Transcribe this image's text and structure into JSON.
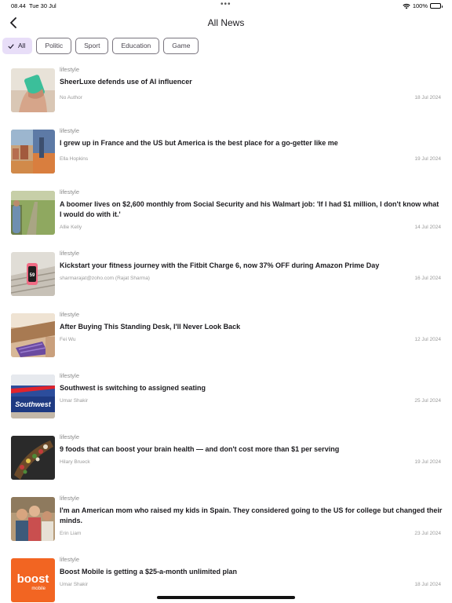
{
  "status_bar": {
    "time": "08.44",
    "date": "Tue 30 Jul",
    "dots": "•••",
    "battery": "100%"
  },
  "header": {
    "title": "All News"
  },
  "filters": [
    {
      "label": "All",
      "selected": true
    },
    {
      "label": "Politic",
      "selected": false
    },
    {
      "label": "Sport",
      "selected": false
    },
    {
      "label": "Education",
      "selected": false
    },
    {
      "label": "Game",
      "selected": false
    }
  ],
  "articles": [
    {
      "category": "lifestyle",
      "title": "SheerLuxe defends use of AI influencer",
      "author": "No Author",
      "date": "18 Jul 2024"
    },
    {
      "category": "lifestyle",
      "title": "I grew up in France and the US but America is the best place for a go-getter like me",
      "author": "Ella Hopkins",
      "date": "19 Jul 2024"
    },
    {
      "category": "lifestyle",
      "title": "A boomer lives on $2,600 monthly from Social Security and his Walmart job: 'If I had $1 million, I don't know what I would do with it.'",
      "author": "Allie Kelly",
      "date": "14 Jul 2024"
    },
    {
      "category": "lifestyle",
      "title": "Kickstart your fitness journey with the Fitbit Charge 6, now 37% OFF during Amazon Prime Day",
      "author": "sharmarajat@zoho.com (Rajat Sharma)",
      "date": "16 Jul 2024"
    },
    {
      "category": "lifestyle",
      "title": "After Buying This Standing Desk, I'll Never Look Back",
      "author": "Fei Wu",
      "date": "12 Jul 2024"
    },
    {
      "category": "lifestyle",
      "title": "Southwest is switching to assigned seating",
      "author": "Umar Shakir",
      "date": "25 Jul 2024"
    },
    {
      "category": "lifestyle",
      "title": "9 foods that can boost your brain health — and don't cost more than $1 per serving",
      "author": "Hilary Brueck",
      "date": "19 Jul 2024"
    },
    {
      "category": "lifestyle",
      "title": "I'm an American mom who raised my kids in Spain. They considered going to the US for college but changed their minds.",
      "author": "Erin Liam",
      "date": "23 Jul 2024"
    },
    {
      "category": "lifestyle",
      "title": "Boost Mobile is getting a $25-a-month unlimited plan",
      "author": "Umar Shakir",
      "date": "18 Jul 2024"
    }
  ],
  "thumbnails": {
    "southwest_text": "Southwest",
    "boost_logo": "boost",
    "boost_sub": "mobile",
    "fitbit_readout": "59"
  },
  "colors": {
    "chip_selected_bg": "#e8def8",
    "chip_border": "#79747e",
    "boost_orange": "#f26522"
  }
}
